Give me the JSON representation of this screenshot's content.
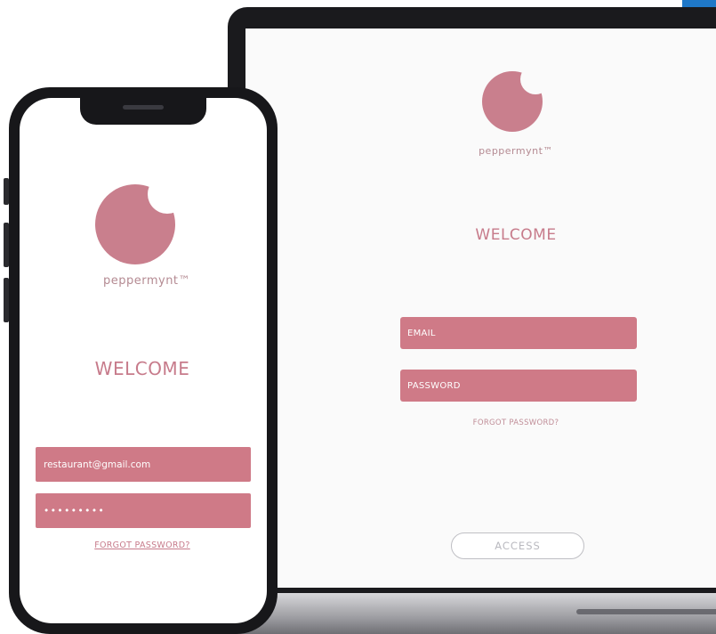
{
  "colors": {
    "accent_pink": "#cf7a87",
    "logo_pink": "#c97f8d",
    "device_dark": "#17171a",
    "corner_blue": "#1f78c8"
  },
  "laptop": {
    "brand": "peppermynt™",
    "welcome": "WELCOME",
    "email_placeholder": "EMAIL",
    "password_placeholder": "PASSWORD",
    "forgot_password": "FORGOT PASSWORD?",
    "access_button": "ACCESS",
    "logo_icon": "peppermynt-logo-icon"
  },
  "phone": {
    "brand": "peppermynt™",
    "welcome": "WELCOME",
    "email_value": "restaurant@gmail.com",
    "password_value": "•••••••••",
    "forgot_password": "FORGOT PASSWORD?",
    "logo_icon": "peppermynt-logo-icon"
  }
}
